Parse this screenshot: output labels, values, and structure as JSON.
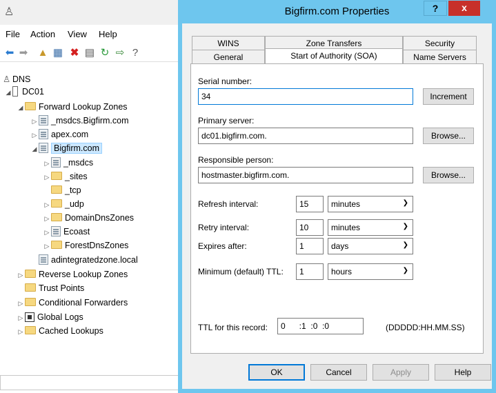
{
  "mmc": {
    "menus": [
      "File",
      "Action",
      "View",
      "Help"
    ],
    "tree": [
      {
        "label": "DNS"
      },
      {
        "label": "DC01"
      },
      {
        "label": "Forward Lookup Zones"
      },
      {
        "label": "_msdcs.Bigfirm.com"
      },
      {
        "label": "apex.com"
      },
      {
        "label": "Bigfirm.com"
      },
      {
        "label": "_msdcs"
      },
      {
        "label": "_sites"
      },
      {
        "label": "_tcp"
      },
      {
        "label": "_udp"
      },
      {
        "label": "DomainDnsZones"
      },
      {
        "label": "Ecoast"
      },
      {
        "label": "ForestDnsZones"
      },
      {
        "label": "adintegratedzone.local"
      },
      {
        "label": "Reverse Lookup Zones"
      },
      {
        "label": "Trust Points"
      },
      {
        "label": "Conditional Forwarders"
      },
      {
        "label": "Global Logs"
      },
      {
        "label": "Cached Lookups"
      }
    ]
  },
  "dialog": {
    "title": "Bigfirm.com Properties",
    "help_glyph": "?",
    "close_glyph": "x",
    "tabs_row1": [
      "WINS",
      "Zone Transfers",
      "Security"
    ],
    "tabs_row2": [
      "General",
      "Start of Authority (SOA)",
      "Name Servers"
    ],
    "serial": {
      "label": "Serial number:",
      "value": "34",
      "button": "Increment"
    },
    "primary": {
      "label": "Primary server:",
      "value": "dc01.bigfirm.com.",
      "button": "Browse..."
    },
    "responsible": {
      "label": "Responsible person:",
      "value": "hostmaster.bigfirm.com.",
      "button": "Browse..."
    },
    "refresh": {
      "label": "Refresh interval:",
      "value": "15",
      "unit": "minutes"
    },
    "retry": {
      "label": "Retry interval:",
      "value": "10",
      "unit": "minutes"
    },
    "expires": {
      "label": "Expires after:",
      "value": "1",
      "unit": "days"
    },
    "min_ttl": {
      "label": "Minimum (default) TTL:",
      "value": "1",
      "unit": "hours"
    },
    "ttl": {
      "label": "TTL for this record:",
      "value": "0      :1  :0  :0",
      "format": "(DDDDD:HH.MM.SS)"
    },
    "buttons": {
      "ok": "OK",
      "cancel": "Cancel",
      "apply": "Apply",
      "help": "Help"
    }
  }
}
